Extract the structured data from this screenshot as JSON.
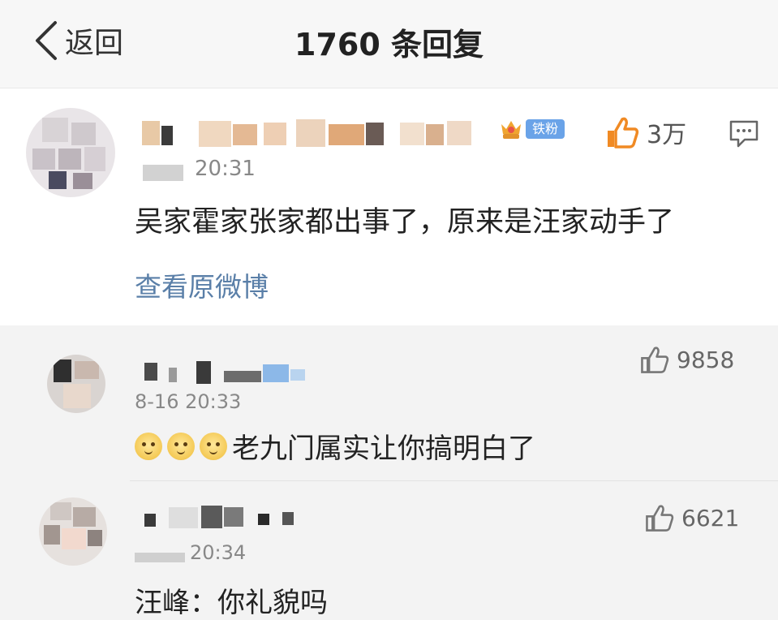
{
  "header": {
    "back_label": "返回",
    "title": "1760 条回复"
  },
  "main_comment": {
    "badge_label": "铁粉",
    "like_count": "3万",
    "time": "20:31",
    "text": "吴家霍家张家都出事了，原来是汪家动手了",
    "view_original": "查看原微博"
  },
  "replies": [
    {
      "like_count": "9858",
      "time": "8-16 20:33",
      "emoji_count": 3,
      "emoji": "doge-icon",
      "text": "老九门属实让你搞明白了"
    },
    {
      "like_count": "6621",
      "time": "20:34",
      "text": "汪峰：你礼貌吗"
    }
  ],
  "colors": {
    "header_bg": "#f7f7f7",
    "replies_bg": "#f3f3f3",
    "link": "#5a7fa8",
    "badge": "#6aa3e8",
    "like_orange": "#f08a24"
  }
}
